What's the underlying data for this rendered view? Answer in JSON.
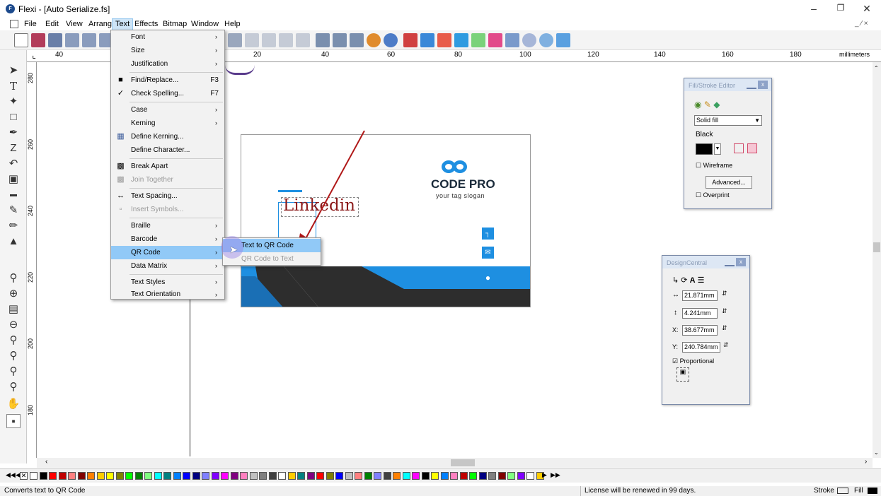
{
  "window": {
    "title": "Flexi - [Auto Serialize.fs]",
    "logo": "F"
  },
  "menubar": {
    "items": [
      "File",
      "Edit",
      "View",
      "Arrange",
      "Text",
      "Effects",
      "Bitmap",
      "Window",
      "Help"
    ],
    "active": "Text"
  },
  "ruler": {
    "h_labels": [
      "40",
      "20",
      "40",
      "60",
      "80",
      "100",
      "120",
      "140",
      "160",
      "180"
    ],
    "unit": "millimeters",
    "v_labels": [
      "280",
      "260",
      "240",
      "220",
      "200",
      "180"
    ]
  },
  "text_menu": {
    "items": [
      {
        "label": "Font",
        "submenu": true
      },
      {
        "label": "Size",
        "submenu": true
      },
      {
        "label": "Justification",
        "submenu": true
      },
      {
        "label": "Find/Replace...",
        "shortcut": "F3",
        "icon": "binoculars-icon"
      },
      {
        "label": "Check Spelling...",
        "shortcut": "F7",
        "icon": "spellcheck-icon"
      },
      {
        "label": "Case",
        "submenu": true
      },
      {
        "label": "Kerning",
        "submenu": true
      },
      {
        "label": "Define Kerning...",
        "icon": "kerning-icon"
      },
      {
        "label": "Define Character..."
      },
      {
        "label": "Break Apart",
        "icon": "break-apart-icon"
      },
      {
        "label": "Join Together",
        "disabled": true,
        "icon": "join-together-icon"
      },
      {
        "label": "Text Spacing...",
        "icon": "text-spacing-icon"
      },
      {
        "label": "Insert Symbols...",
        "disabled": true,
        "icon": "insert-symbols-icon"
      },
      {
        "label": "Braille",
        "submenu": true
      },
      {
        "label": "Barcode",
        "submenu": true
      },
      {
        "label": "QR Code",
        "submenu": true,
        "highlighted": true
      },
      {
        "label": "Data Matrix",
        "submenu": true
      },
      {
        "label": "Text Styles",
        "submenu": true
      },
      {
        "label": "Text Orientation",
        "submenu": true
      }
    ]
  },
  "qr_submenu": {
    "items": [
      {
        "label": "Text to QR Code",
        "highlighted": true
      },
      {
        "label": "QR Code to Text",
        "disabled": true
      }
    ]
  },
  "card": {
    "brand": "CODE PRO",
    "slogan": "your tag slogan",
    "selected_text": "Linkedin",
    "accent_color": "#1e8fe1",
    "dark_color": "#2d2d2d",
    "text_color": "#8b1a1a"
  },
  "fill_stroke_editor": {
    "title": "Fill/Stroke Editor",
    "fill_type": "Solid fill",
    "color_name": "Black",
    "wireframe_label": "Wireframe",
    "advanced_label": "Advanced...",
    "overprint_label": "Overprint"
  },
  "design_central": {
    "title": "DesignCentral",
    "width": "21.871mm",
    "height": "4.241mm",
    "x_label": "X:",
    "x_value": "38.677mm",
    "y_label": "Y:",
    "y_value": "240.784mm",
    "proportional_label": "Proportional"
  },
  "status": {
    "hint": "Converts text to QR Code",
    "license": "License will be renewed in 99 days.",
    "stroke_label": "Stroke",
    "fill_label": "Fill"
  },
  "palette_colors": [
    "#ffffff",
    "#000000",
    "#ff0000",
    "#c00000",
    "#ff8080",
    "#800000",
    "#ff8000",
    "#ffcc00",
    "#ffff00",
    "#808000",
    "#00ff00",
    "#008000",
    "#80ff80",
    "#00ffff",
    "#008080",
    "#0080ff",
    "#0000ff",
    "#000080",
    "#8080ff",
    "#8000ff",
    "#ff00ff",
    "#800080",
    "#ff80c0",
    "#c0c0c0",
    "#808080",
    "#404040"
  ]
}
